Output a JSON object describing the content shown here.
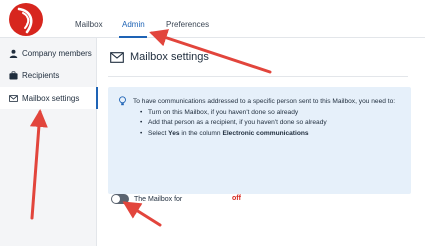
{
  "colors": {
    "accent": "#1e63b5",
    "brand": "#d7261e",
    "arrow": "#e2453c",
    "info_bg": "#e6f0fa"
  },
  "header": {
    "logo_icon": "brand-logo-icon",
    "tabs": [
      {
        "label": "Mailbox",
        "active": false
      },
      {
        "label": "Admin",
        "active": true
      },
      {
        "label": "Preferences",
        "active": false
      }
    ]
  },
  "sidebar": {
    "items": [
      {
        "label": "Company members",
        "icon": "person-icon",
        "active": false
      },
      {
        "label": "Recipients",
        "icon": "briefcase-icon",
        "active": false
      },
      {
        "label": "Mailbox settings",
        "icon": "envelope-icon",
        "active": true
      }
    ]
  },
  "main": {
    "title": "Mailbox settings",
    "title_icon": "envelope-icon",
    "info": {
      "icon": "lightbulb-icon",
      "intro": "To have communications addressed to a specific person sent to this Mailbox, you need to:",
      "items": [
        "Turn on this Mailbox, if you haven't done so already",
        "Add that person as a recipient, if you haven't done so already"
      ],
      "last_item_prefix": "Select ",
      "last_item_bold1": "Yes",
      "last_item_middle": " in the column ",
      "last_item_bold2": "Electronic communications"
    },
    "toggle": {
      "label": "The Mailbox for",
      "state": "off",
      "on": false
    }
  }
}
